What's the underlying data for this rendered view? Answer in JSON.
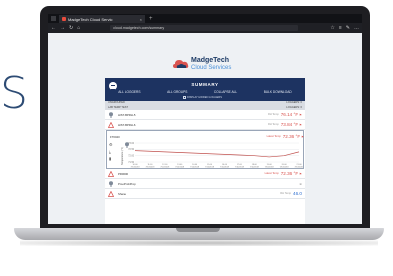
{
  "background_text": "S",
  "browser": {
    "tab_title": "MadgeTech Cloud Servic",
    "tab_close": "×",
    "new_tab": "+",
    "url": "cloud.madgetech.com/summary",
    "nav_icons": [
      "←",
      "→",
      "↻",
      "⌂"
    ],
    "right_icons": [
      "☆",
      "≡",
      "✎",
      "…"
    ]
  },
  "logo": {
    "line1": "MadgeTech",
    "line2": "Cloud Services"
  },
  "summary": {
    "title": "SUMMARY",
    "actions": [
      "ALL LOGGERS",
      "ALL GROUPS",
      "COLLAPSE ALL",
      "BULK DOWNLOAD"
    ],
    "checkbox_label": "DISPLAY HIDDEN LOGGERS"
  },
  "groups": [
    {
      "name": "UNGROUPED",
      "count": "LOGGERS: 0"
    },
    {
      "name": "LAB TEMP TEST",
      "count": "LOGGERS: 6"
    }
  ],
  "loggers": [
    {
      "name": "HIST-BPRH-5",
      "label": "RH Temp",
      "value": "76.14 °F",
      "icon": "thermometer-icon",
      "alarm": true
    },
    {
      "name": "HIST-BPRH-6",
      "label": "RH Temp",
      "value": "73.84 °F",
      "icon": "alarm-bell-icon",
      "alarm": true
    },
    {
      "name": "FT0040",
      "label": "Latest Temp",
      "value": "72.36 °F",
      "icon": "thermometer-icon",
      "alarm": true
    },
    {
      "name": "PR0000",
      "label": "Latest Temp",
      "value": "72.36 °F",
      "icon": "alarm-bell-icon",
      "alarm": true
    },
    {
      "name": "ProoProbProp",
      "label": "",
      "value": "",
      "icon": "thermometer-icon",
      "alarm": false
    },
    {
      "name": "Shane",
      "label": "RH Temp",
      "value": "46.0",
      "icon": "alarm-bell-icon",
      "alarm": false
    }
  ],
  "side_icons": [
    "⚙",
    "⤓",
    "▮"
  ],
  "colors": {
    "navy": "#1d3361",
    "alarm": "#d9534f",
    "blue": "#2e6fd0",
    "line": "#c0504d"
  },
  "chart_data": {
    "type": "line",
    "title": "",
    "ylabel": "Temperature (°F)",
    "xlabel": "",
    "y_ticks": [
      "73.00",
      "72.50",
      "72.00",
      "71.50"
    ],
    "categories": [
      "10:00 7/10/2018",
      "11:00 7/10/2018",
      "12:00 7/10/2018",
      "13:00 7/10/2018",
      "14:00 7/10/2018",
      "15:00 7/10/2018",
      "16:00 7/10/2018",
      "17:00 7/10/2018",
      "18:00 7/10/2018",
      "19:00 7/10/2018",
      "20:00 7/10/2018",
      "21:00 7/10/2018"
    ],
    "series": [
      {
        "values": [
          72.4,
          72.35,
          72.3,
          72.25,
          72.2,
          72.15,
          72.1,
          72.05,
          72.0,
          71.9,
          72.0,
          72.3
        ]
      }
    ],
    "ylim": [
      71.5,
      73.0
    ]
  }
}
